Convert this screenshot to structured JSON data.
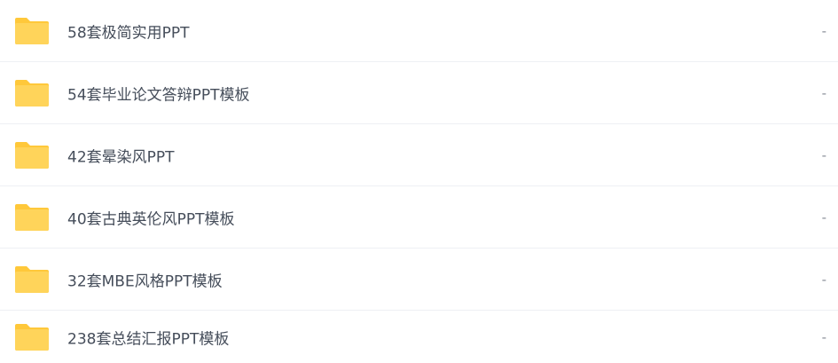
{
  "files": [
    {
      "name": "58套极简实用PPT",
      "icon": "folder-icon",
      "meta": "-"
    },
    {
      "name": "54套毕业论文答辩PPT模板",
      "icon": "folder-icon",
      "meta": "-"
    },
    {
      "name": "42套晕染风PPT",
      "icon": "folder-icon",
      "meta": "-"
    },
    {
      "name": "40套古典英伦风PPT模板",
      "icon": "folder-icon",
      "meta": "-"
    },
    {
      "name": "32套MBE风格PPT模板",
      "icon": "folder-icon",
      "meta": "-"
    },
    {
      "name": "238套总结汇报PPT模板",
      "icon": "folder-icon",
      "meta": "-"
    }
  ],
  "colors": {
    "folder": "#ffd45a",
    "folder_tab": "#ffc83a",
    "text": "#454d5a",
    "divider": "#eef0f4"
  }
}
